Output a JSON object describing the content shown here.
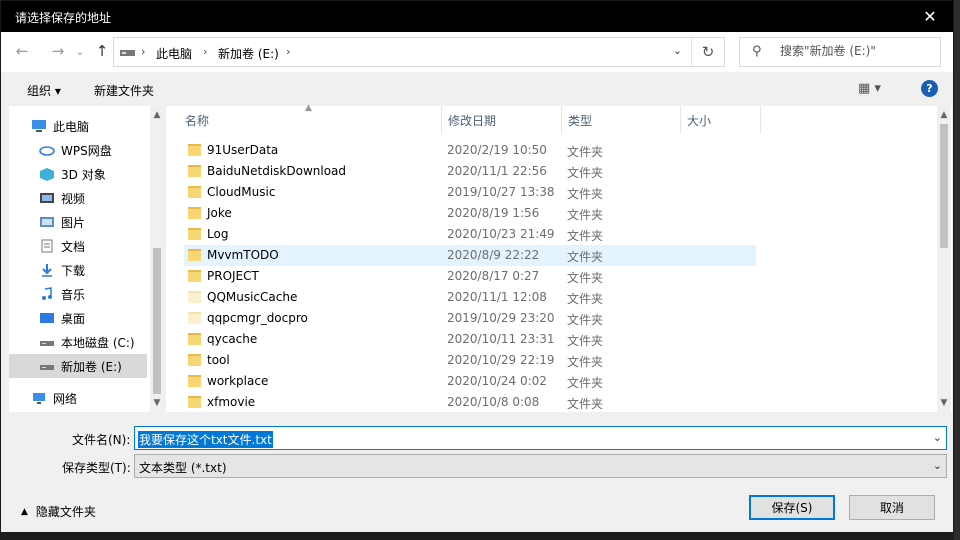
{
  "title": "请选择保存的地址",
  "close_glyph": "✕",
  "nav": {
    "back_icon": "←",
    "forward_icon": "→",
    "recent_icon": "⌄",
    "up_icon": "↑"
  },
  "address": {
    "segments": [
      "此电脑",
      "新加卷 (E:)"
    ],
    "chevron": "›",
    "dropdown": "⌄",
    "refresh": "↻"
  },
  "search": {
    "placeholder": "搜索\"新加卷 (E:)\"",
    "icon": "⚲"
  },
  "toolbar": {
    "organize": "组织 ▾",
    "new_folder": "新建文件夹",
    "view_icon": "▦ ▾",
    "help": "?"
  },
  "sidebar": {
    "items": [
      {
        "label": "此电脑",
        "icon": "computer-icon"
      },
      {
        "label": "WPS网盘",
        "icon": "cloud-icon"
      },
      {
        "label": "3D 对象",
        "icon": "cube-icon"
      },
      {
        "label": "视频",
        "icon": "video-icon"
      },
      {
        "label": "图片",
        "icon": "picture-icon"
      },
      {
        "label": "文档",
        "icon": "document-icon"
      },
      {
        "label": "下载",
        "icon": "download-icon"
      },
      {
        "label": "音乐",
        "icon": "music-icon"
      },
      {
        "label": "桌面",
        "icon": "desktop-icon"
      },
      {
        "label": "本地磁盘 (C:)",
        "icon": "drive-icon"
      },
      {
        "label": "新加卷 (E:)",
        "icon": "drive-icon"
      },
      {
        "label": "网络",
        "icon": "network-icon"
      }
    ]
  },
  "columns": {
    "name": "名称",
    "date": "修改日期",
    "type": "类型",
    "size": "大小"
  },
  "files": [
    {
      "name": "91UserData",
      "date": "2020/2/19 10:50",
      "type": "文件夹"
    },
    {
      "name": "BaiduNetdiskDownload",
      "date": "2020/11/1 22:56",
      "type": "文件夹"
    },
    {
      "name": "CloudMusic",
      "date": "2019/10/27 13:38",
      "type": "文件夹"
    },
    {
      "name": "Joke",
      "date": "2020/8/19 1:56",
      "type": "文件夹"
    },
    {
      "name": "Log",
      "date": "2020/10/23 21:49",
      "type": "文件夹"
    },
    {
      "name": "MvvmTODO",
      "date": "2020/8/9 22:22",
      "type": "文件夹"
    },
    {
      "name": "PROJECT",
      "date": "2020/8/17 0:27",
      "type": "文件夹"
    },
    {
      "name": "QQMusicCache",
      "date": "2020/11/1 12:08",
      "type": "文件夹"
    },
    {
      "name": "qqpcmgr_docpro",
      "date": "2019/10/29 23:20",
      "type": "文件夹"
    },
    {
      "name": "qycache",
      "date": "2020/10/11 23:31",
      "type": "文件夹"
    },
    {
      "name": "tool",
      "date": "2020/10/29 22:19",
      "type": "文件夹"
    },
    {
      "name": "workplace",
      "date": "2020/10/24 0:02",
      "type": "文件夹"
    },
    {
      "name": "xfmovie",
      "date": "2020/10/8 0:08",
      "type": "文件夹"
    }
  ],
  "form": {
    "filename_label": "文件名(N):",
    "filename_value": "我要保存这个txt文件.txt",
    "filetype_label": "保存类型(T):",
    "filetype_value": "文本类型 (*.txt)",
    "hide_folders": "隐藏文件夹",
    "save": "保存(S)",
    "cancel": "取消"
  }
}
